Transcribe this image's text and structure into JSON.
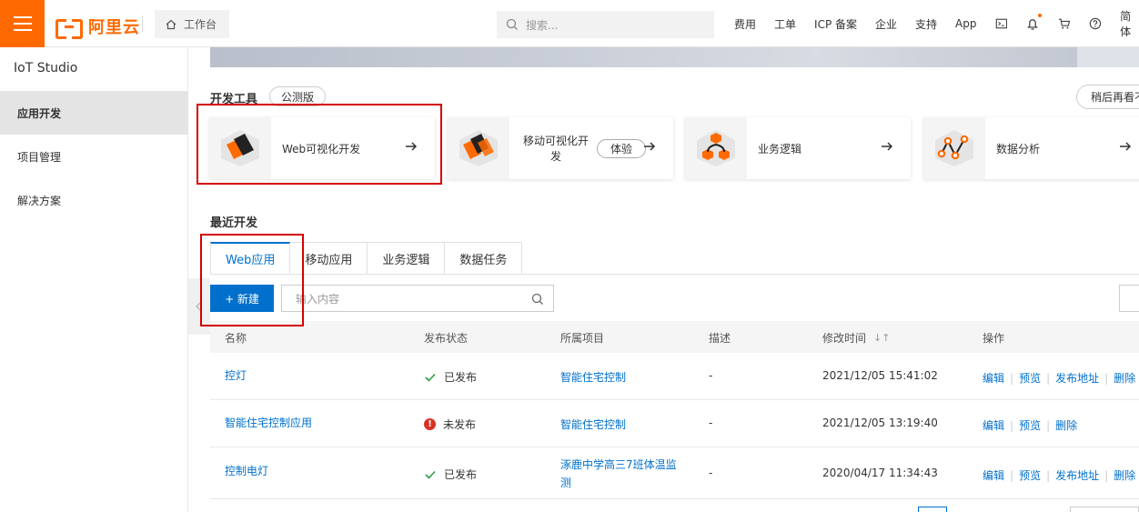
{
  "header": {
    "brand": "阿里云",
    "workbench_label": "工作台",
    "search_placeholder": "搜索...",
    "links": [
      "费用",
      "工单",
      "ICP 备案",
      "企业",
      "支持",
      "App"
    ],
    "lang_label": "简体"
  },
  "sidebar": {
    "title": "IoT Studio",
    "items": [
      {
        "label": "应用开发",
        "active": true
      },
      {
        "label": "项目管理",
        "active": false
      },
      {
        "label": "解决方案",
        "active": false
      }
    ]
  },
  "dev_tools": {
    "title": "开发工具",
    "badge": "公测版",
    "later_button": "稍后再看不",
    "cards": [
      {
        "label": "Web可视化开发",
        "icon": "web-dev-icon"
      },
      {
        "label": "移动可视化开发",
        "tag": "体验",
        "icon": "mobile-dev-icon"
      },
      {
        "label": "业务逻辑",
        "icon": "business-logic-icon"
      },
      {
        "label": "数据分析",
        "icon": "data-analysis-icon"
      }
    ]
  },
  "recent": {
    "title": "最近开发",
    "tabs": [
      {
        "label": "Web应用",
        "active": true
      },
      {
        "label": "移动应用",
        "active": false
      },
      {
        "label": "业务逻辑",
        "active": false
      },
      {
        "label": "数据任务",
        "active": false
      }
    ],
    "new_button": "+ 新建",
    "search_placeholder": "输入内容",
    "columns": [
      "名称",
      "发布状态",
      "所属项目",
      "描述",
      "修改时间",
      "操作"
    ],
    "rows": [
      {
        "name": "控灯",
        "status": "已发布",
        "published": true,
        "project": "智能住宅控制",
        "desc": "-",
        "modified": "2021/12/05 15:41:02",
        "ops": [
          "编辑",
          "预览",
          "发布地址",
          "删除"
        ]
      },
      {
        "name": "智能住宅控制应用",
        "status": "未发布",
        "published": false,
        "project": "智能住宅控制",
        "desc": "-",
        "modified": "2021/12/05 13:19:40",
        "ops": [
          "编辑",
          "预览",
          "删除"
        ]
      },
      {
        "name": "控制电灯",
        "status": "已发布",
        "published": true,
        "project": "涿鹿中学高三7班体温监测",
        "desc": "-",
        "modified": "2020/04/17 11:34:43",
        "ops": [
          "编辑",
          "预览",
          "发布地址",
          "删除"
        ]
      }
    ]
  },
  "colors": {
    "brand": "#ff6a00",
    "primary": "#0070cc",
    "highlight": "#d40000",
    "success": "#2e9e44",
    "error": "#d93026"
  }
}
